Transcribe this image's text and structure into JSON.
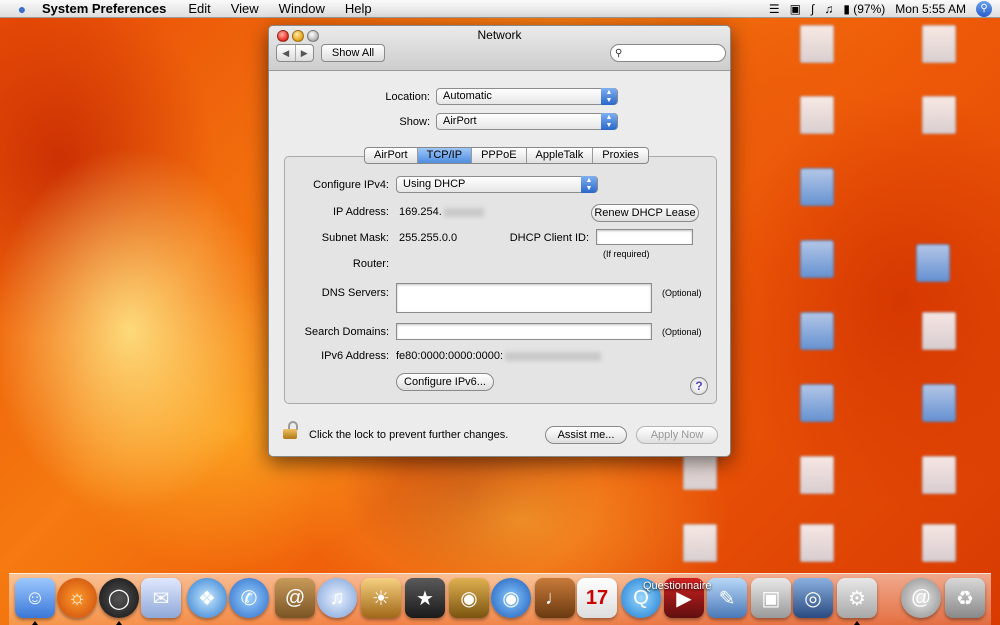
{
  "menubar": {
    "app_name": "System Preferences",
    "menus": [
      "Edit",
      "View",
      "Window",
      "Help"
    ],
    "battery": "(97%)",
    "clock": "Mon 5:55 AM"
  },
  "window": {
    "title": "Network",
    "show_all": "Show All",
    "location_label": "Location:",
    "location_value": "Automatic",
    "show_label": "Show:",
    "show_value": "AirPort",
    "tabs": [
      "AirPort",
      "TCP/IP",
      "PPPoE",
      "AppleTalk",
      "Proxies"
    ],
    "selected_tab": "TCP/IP",
    "configure_ipv4_label": "Configure IPv4:",
    "configure_ipv4_value": "Using DHCP",
    "ip_label": "IP Address:",
    "ip_value": "169.254.",
    "renew_button": "Renew DHCP Lease",
    "subnet_label": "Subnet Mask:",
    "subnet_value": "255.255.0.0",
    "dhcp_client_label": "DHCP Client ID:",
    "dhcp_client_value": "",
    "if_required": "(If required)",
    "router_label": "Router:",
    "dns_label": "DNS Servers:",
    "optional": "(Optional)",
    "search_domains_label": "Search Domains:",
    "ipv6_label": "IPv6 Address:",
    "ipv6_value": "fe80:0000:0000:0000:",
    "configure_ipv6_button": "Configure IPv6...",
    "help": "?",
    "lock_text": "Click the lock to prevent further changes.",
    "assist_button": "Assist me...",
    "apply_button": "Apply Now"
  },
  "dock": {
    "label": "Questionnaire"
  }
}
